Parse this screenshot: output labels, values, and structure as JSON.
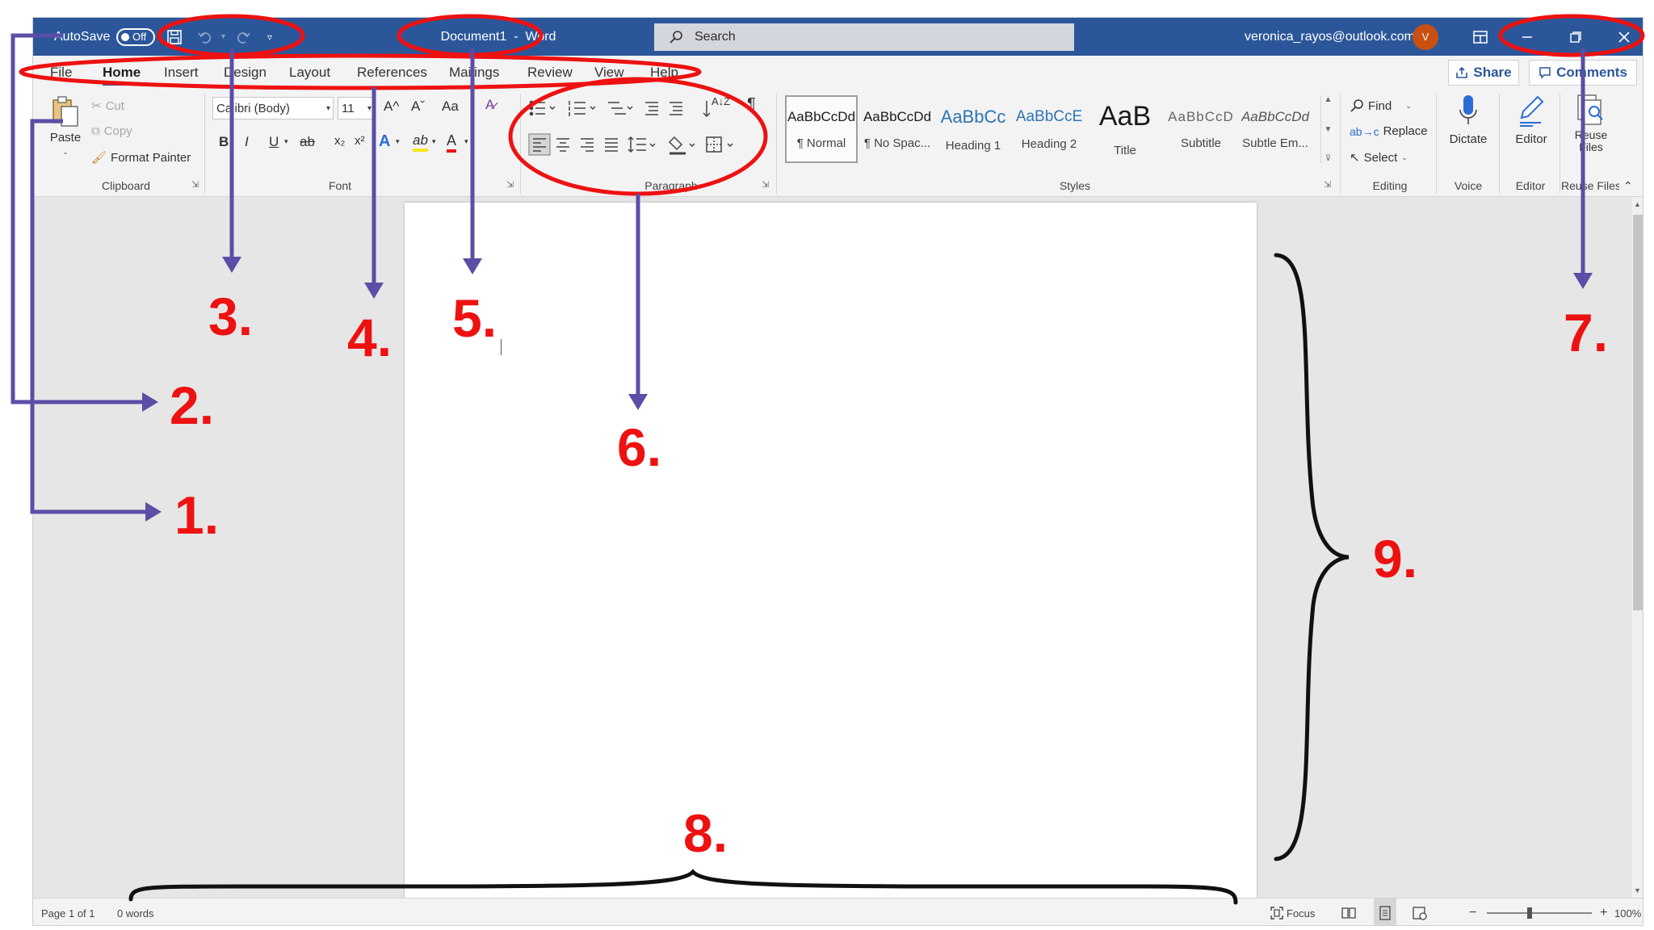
{
  "titlebar": {
    "autosave_label": "AutoSave",
    "autosave_state": "Off",
    "document_name": "Document1",
    "title_sep": "-",
    "app_name": "Word",
    "search_label": "Search",
    "account_email": "veronica_rayos@outlook.com",
    "avatar_initial": "V",
    "accent_color": "#2b579a",
    "avatar_color": "#ca5010"
  },
  "menu": {
    "tabs": [
      {
        "label": "File"
      },
      {
        "label": "Home",
        "active": true
      },
      {
        "label": "Insert"
      },
      {
        "label": "Design"
      },
      {
        "label": "Layout"
      },
      {
        "label": "References"
      },
      {
        "label": "Mailings"
      },
      {
        "label": "Review"
      },
      {
        "label": "View"
      },
      {
        "label": "Help"
      }
    ],
    "share_label": "Share",
    "comments_label": "Comments"
  },
  "ribbon": {
    "clipboard": {
      "paste_label": "Paste",
      "cut_label": "Cut",
      "copy_label": "Copy",
      "format_painter_label": "Format Painter",
      "group_label": "Clipboard"
    },
    "font": {
      "font_name": "Calibri (Body)",
      "font_size": "11",
      "grow_glyph": "A^",
      "shrink_glyph": "Aˇ",
      "case_glyph": "Aa",
      "bold_glyph": "B",
      "italic_glyph": "I",
      "underline_glyph": "U",
      "strike_glyph": "ab",
      "subscript_glyph": "x₂",
      "superscript_glyph": "x²",
      "effects_glyph": "A",
      "highlight_glyph": "ab",
      "font_color_glyph": "A",
      "group_label": "Font"
    },
    "paragraph": {
      "sort_glyph": "A↓Z",
      "pilcrow_glyph": "¶",
      "group_label": "Paragraph"
    },
    "styles": {
      "items": [
        {
          "preview": "AaBbCcDd",
          "name": "¶ Normal",
          "selected": true
        },
        {
          "preview": "AaBbCcDd",
          "name": "¶ No Spac..."
        },
        {
          "preview": "AaBbCc",
          "name": "Heading 1"
        },
        {
          "preview": "AaBbCcE",
          "name": "Heading 2"
        },
        {
          "preview": "AaB",
          "name": "Title"
        },
        {
          "preview": "AaBbCcD",
          "name": "Subtitle"
        },
        {
          "preview": "AaBbCcDd",
          "name": "Subtle Em..."
        }
      ],
      "group_label": "Styles"
    },
    "editing": {
      "find_label": "Find",
      "replace_label": "Replace",
      "select_label": "Select",
      "group_label": "Editing"
    },
    "voice": {
      "dictate_label": "Dictate",
      "group_label": "Voice"
    },
    "editor": {
      "editor_label": "Editor",
      "group_label": "Editor"
    },
    "reuse": {
      "reuse_label": "Reuse Files",
      "group_label": "Reuse Files"
    }
  },
  "statusbar": {
    "page_info": "Page 1 of 1",
    "word_count": "0 words",
    "focus_label": "Focus",
    "zoom_minus": "−",
    "zoom_plus": "+",
    "zoom_level": "100%"
  },
  "annotations": {
    "callouts": [
      "1.",
      "2.",
      "3.",
      "4.",
      "5.",
      "6.",
      "7.",
      "8.",
      "9."
    ],
    "circle_color": "#ee1111",
    "arrow_color": "#5b4ea6"
  }
}
